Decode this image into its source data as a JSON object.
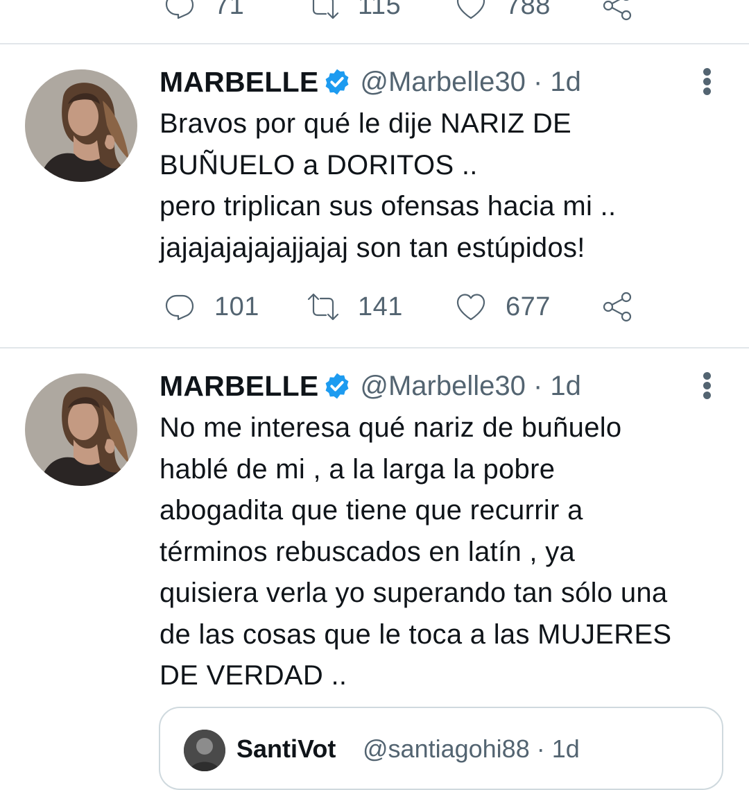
{
  "top_tweet": {
    "actions": {
      "replies": "71",
      "retweets": "115",
      "likes": "788"
    }
  },
  "tweets": [
    {
      "name": "MARBELLE",
      "handle_time": "@Marbelle30 · 1d",
      "text": "Bravos por qué le dije NARIZ DE\nBUÑUELO  a DORITOS ..\npero triplican sus ofensas hacia mi ..\njajajajajajajjajaj son tan estúpidos!",
      "actions": {
        "replies": "101",
        "retweets": "141",
        "likes": "677"
      }
    },
    {
      "name": "MARBELLE",
      "handle_time": "@Marbelle30 · 1d",
      "text": "No me interesa qué nariz de buñuelo\nhablé de mi , a la larga la pobre\nabogadita que tiene que recurrir a\ntérminos rebuscados en latín , ya\nquisiera verla yo superando tan sólo una\nde las cosas que le toca a las MUJERES\nDE VERDAD ..",
      "quoted": {
        "name": "SantiVot",
        "handle_time": "@santiagohi88 · 1d"
      }
    }
  ],
  "icons": {
    "reply": "reply-icon",
    "retweet": "retweet-icon",
    "like": "heart-icon",
    "share": "share-icon",
    "verified": "verified-badge-icon",
    "more": "more-options-icon"
  },
  "colors": {
    "text_primary": "#0f1419",
    "text_secondary": "#536471",
    "verified": "#1d9bf0",
    "divider": "#e1e6ea"
  }
}
